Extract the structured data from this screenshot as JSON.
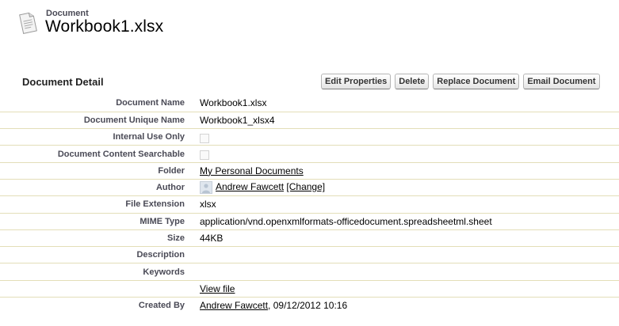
{
  "header": {
    "kind": "Document",
    "title": "Workbook1.xlsx",
    "icon": "document-icon"
  },
  "detail": {
    "section_title": "Document Detail",
    "buttons": {
      "edit": "Edit Properties",
      "delete": "Delete",
      "replace": "Replace Document",
      "email": "Email Document"
    },
    "rows": {
      "name": {
        "label": "Document Name",
        "value": "Workbook1.xlsx"
      },
      "unique_name": {
        "label": "Document Unique Name",
        "value": "Workbook1_xlsx4"
      },
      "internal": {
        "label": "Internal Use Only",
        "checked": false
      },
      "searchable": {
        "label": "Document Content Searchable",
        "checked": false
      },
      "folder": {
        "label": "Folder",
        "value": "My Personal Documents"
      },
      "author": {
        "label": "Author",
        "value": "Andrew Fawcett",
        "change": "[Change]"
      },
      "extension": {
        "label": "File Extension",
        "value": "xlsx"
      },
      "mime": {
        "label": "MIME Type",
        "value": "application/vnd.openxmlformats-officedocument.spreadsheetml.sheet"
      },
      "size": {
        "label": "Size",
        "value": "44KB"
      },
      "description": {
        "label": "Description",
        "value": ""
      },
      "keywords": {
        "label": "Keywords",
        "value": ""
      },
      "view": {
        "label": "",
        "value": "View file"
      },
      "created": {
        "label": "Created By",
        "user": "Andrew Fawcett",
        "date": ", 09/12/2012 10:16"
      }
    }
  },
  "colors": {
    "label_text": "#4a4a56",
    "row_divider": "#e3deb8",
    "button_border": "#b5b5b5"
  }
}
